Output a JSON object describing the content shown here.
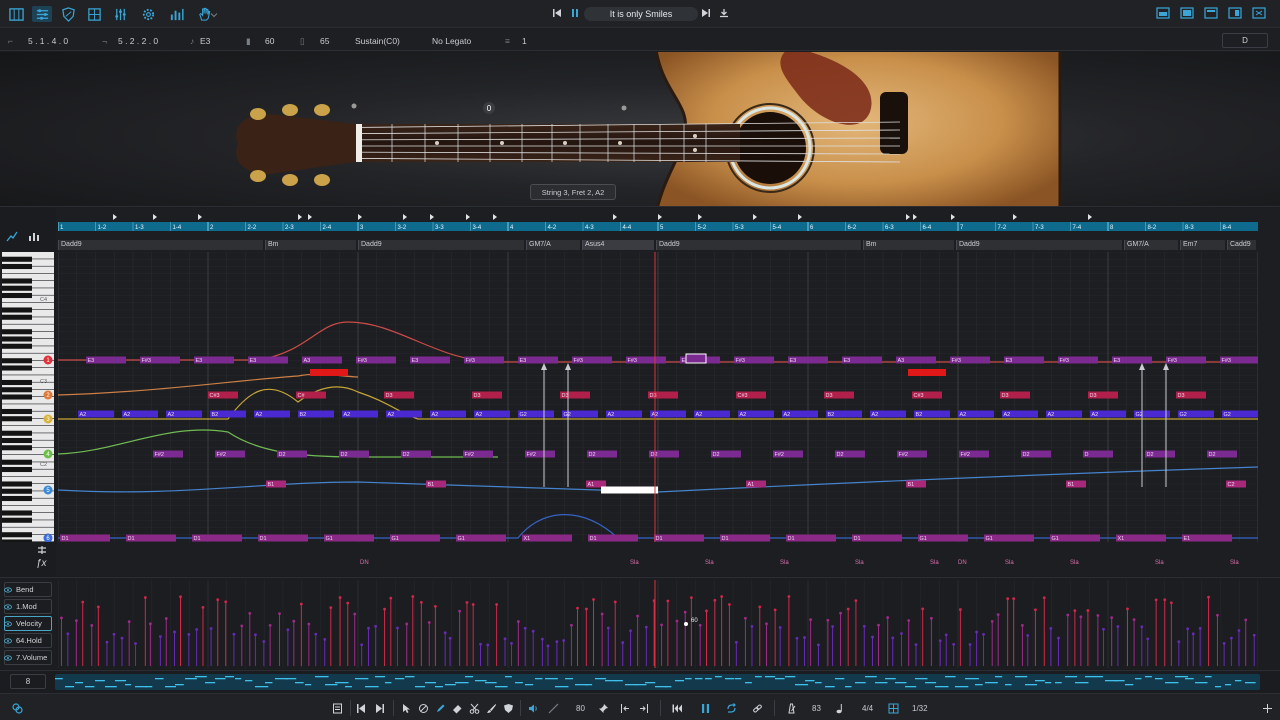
{
  "toolbar": {
    "icons": [
      "piano-icon",
      "mixer-icon",
      "shield-icon",
      "grid-icon",
      "sliders-icon",
      "gear-icon",
      "bars-icon",
      "hand-icon"
    ],
    "song_title": "It is only Smiles",
    "window_icons": [
      "layout-a-icon",
      "layout-b-icon",
      "layout-c-icon",
      "layout-d-icon",
      "layout-e-icon"
    ]
  },
  "infobar": {
    "position_a": "5 . 1 . 4 . 0",
    "position_b": "5 . 2 . 2 . 0",
    "note": "E3",
    "velocity": "60",
    "value2": "65",
    "articulation": "Sustain(C0)",
    "legato": "No Legato",
    "string_count": "1",
    "dropdown": "D"
  },
  "guitar": {
    "capo_label": "0",
    "tooltip": "String 3, Fret 2, A2"
  },
  "timeline": {
    "labels": [
      "1",
      "1-2",
      "1-3",
      "1-4",
      "2",
      "2-2",
      "2-3",
      "2-4",
      "3",
      "3-2",
      "3-3",
      "3-4",
      "4",
      "4-2",
      "4-3",
      "4-4",
      "5",
      "5-2",
      "5-3",
      "5-4",
      "6",
      "6-2",
      "6-3",
      "6-4",
      "7",
      "7-2",
      "7-3",
      "7-4",
      "8",
      "8-2",
      "8-3",
      "8-4"
    ]
  },
  "chords": [
    {
      "name": "Dadd9"
    },
    {
      "name": "Bm"
    },
    {
      "name": "Dadd9"
    },
    {
      "name": "GM7/A"
    },
    {
      "name": "Asus4"
    },
    {
      "name": "Dadd9"
    },
    {
      "name": "Bm"
    },
    {
      "name": "Dadd9"
    },
    {
      "name": "GM7/A"
    },
    {
      "name": "Em7"
    },
    {
      "name": "Cadd9"
    }
  ],
  "strings": [
    "1",
    "2",
    "3",
    "4",
    "5",
    "6"
  ],
  "octave_labels": [
    "C4",
    "C3",
    "C2"
  ],
  "fx_labels": [
    "DN",
    "Sla",
    "Sla",
    "Sla",
    "Sla",
    "Sla",
    "DN",
    "Sla",
    "Sla",
    "Sla",
    "Sla"
  ],
  "notes": {
    "s1": [
      "E3",
      "F#3",
      "E3",
      "E3",
      "A3",
      "F#3",
      "E3",
      "F#3",
      "E3",
      "F#3",
      "F#3",
      "E3",
      "F#3",
      "E3",
      "E3",
      "A3",
      "F#3",
      "E3",
      "F#3",
      "E3",
      "F#3",
      "F#3"
    ],
    "s2": [
      "C#3",
      "C#",
      "D3",
      "D3",
      "D3",
      "D3",
      "C#3",
      "D3",
      "C#3",
      "D3",
      "D3",
      "D3",
      "D3"
    ],
    "s3": [
      "A2",
      "A2",
      "A2",
      "B2",
      "A2",
      "B2",
      "A2",
      "A2",
      "A2",
      "A2",
      "G2",
      "G2",
      "A2",
      "A2",
      "A2",
      "A2",
      "A2",
      "B2",
      "A2",
      "B2",
      "A2",
      "A2",
      "A2",
      "A2",
      "G2",
      "G2",
      "G2"
    ],
    "s4": [
      "F#2",
      "F#2",
      "D2",
      "D2",
      "D2",
      "F#2",
      "F#2",
      "D2",
      "D2",
      "D2",
      "F#2",
      "D2",
      "F#2",
      "F#2",
      "D2",
      "D",
      "D2",
      "D2",
      "E2"
    ],
    "s5": [
      "B1",
      "B1",
      "A1",
      "A1",
      "B1",
      "B1",
      "C2"
    ],
    "s6": [
      "D1",
      "D1",
      "D1",
      "D1",
      "G1",
      "G1",
      "G1",
      "X1",
      "D1",
      "D1",
      "D1",
      "D1",
      "D1",
      "G1",
      "G1",
      "G1",
      "X1",
      "E1"
    ]
  },
  "controllers": {
    "lanes": [
      "Bend",
      "1.Mod",
      "Velocity",
      "64.Hold",
      "7.Volume"
    ],
    "active": "Velocity",
    "cursor_value": "60"
  },
  "overview": {
    "zoom": "8"
  },
  "bottombar": {
    "value_a": "80",
    "value_b": "83",
    "time_signature": "4/4",
    "quantize": "1/32"
  },
  "colors": {
    "accent": "#2f9ed8",
    "timeline": "#0f6b8e",
    "note_purple": "#7a2a90",
    "note_red": "#c8182e",
    "note_blue": "#4a2ad0"
  }
}
